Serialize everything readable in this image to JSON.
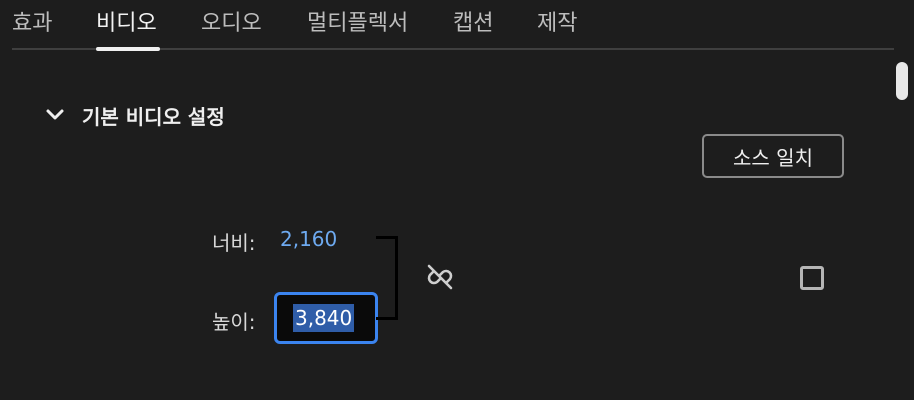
{
  "tabs": [
    {
      "label": "효과",
      "active": false
    },
    {
      "label": "비디오",
      "active": true
    },
    {
      "label": "오디오",
      "active": false
    },
    {
      "label": "멀티플렉서",
      "active": false
    },
    {
      "label": "캡션",
      "active": false
    },
    {
      "label": "제작",
      "active": false
    }
  ],
  "section": {
    "title": "기본 비디오 설정",
    "expanded": true,
    "chevron_icon": "chevron-down-icon"
  },
  "match_source_label": "소스 일치",
  "width": {
    "label": "너비:",
    "value": "2,160"
  },
  "height": {
    "label": "높이:",
    "value": "3,840"
  },
  "link_icon": "unlink-icon",
  "checkbox_checked": false,
  "colors": {
    "background": "#1d1d1d",
    "accent_blue": "#3b84ef",
    "value_blue": "#6eaaf0"
  }
}
